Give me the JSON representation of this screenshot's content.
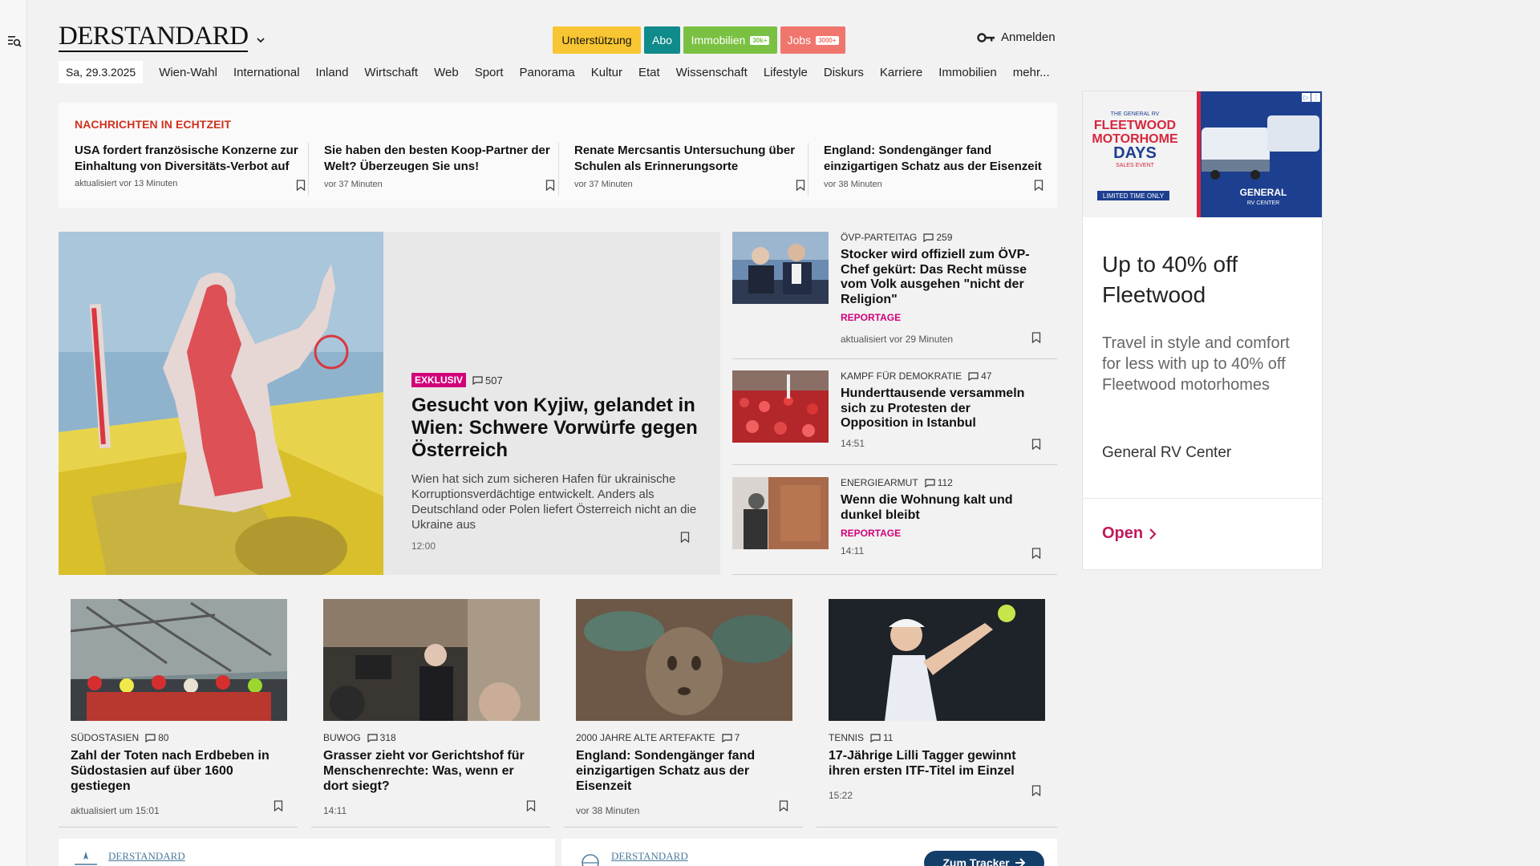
{
  "header": {
    "logo": "DERSTANDARD",
    "cta": [
      {
        "label": "Unterstützung"
      },
      {
        "label": "Abo"
      },
      {
        "label": "Immobilien",
        "badge": "30k+"
      },
      {
        "label": "Jobs",
        "badge": "3000+"
      }
    ],
    "login_label": "Anmelden"
  },
  "nav": {
    "date": "Sa, 29.3.2025",
    "items": [
      "Wien-Wahl",
      "International",
      "Inland",
      "Wirtschaft",
      "Web",
      "Sport",
      "Panorama",
      "Kultur",
      "Etat",
      "Wissenschaft",
      "Lifestyle",
      "Diskurs",
      "Karriere",
      "Immobilien",
      "mehr..."
    ]
  },
  "ticker": {
    "title": "NACHRICHTEN IN ECHTZEIT",
    "items": [
      {
        "title": "USA fordert französische Konzerne zur Einhaltung von Diversitäts-Verbot auf",
        "meta": "aktualisiert vor 13 Minuten"
      },
      {
        "title": "Sie haben den besten Koop-Partner der Welt? Überzeugen Sie uns!",
        "meta": "vor 37 Minuten"
      },
      {
        "title": "Renate Mercsantis Untersuchung über Schulen als Erinnerungsorte",
        "meta": "vor 37 Minuten"
      },
      {
        "title": "England: Sondengänger fand einzigartigen Schatz aus der Eisenzeit",
        "meta": "vor 38 Minuten"
      }
    ]
  },
  "hero": {
    "badge": "EXKLUSIV",
    "comments": "507",
    "title": "Gesucht von Kyjiw, gelandet in Wien: Schwere Vorwürfe gegen Österreich",
    "lead": "Wien hat sich zum sicheren Hafen für ukrainische Korruptionsverdächtige entwickelt. Anders als Deutschland oder Polen liefert Österreich nicht an die Ukraine aus",
    "time": "12:00"
  },
  "side": [
    {
      "kicker": "ÖVP-Parteitag",
      "comments": "259",
      "title": "Stocker wird offiziell zum ÖVP-Chef gekürt: Das Recht müsse vom Volk ausgehen \"nicht der Religion\"",
      "tag": "REPORTAGE",
      "time": "aktualisiert vor 29 Minuten"
    },
    {
      "kicker": "Kampf für Demokratie",
      "comments": "47",
      "title": "Hunderttausende versammeln sich zu Protesten der Opposition in Istanbul",
      "tag": "",
      "time": "14:51"
    },
    {
      "kicker": "Energiearmut",
      "comments": "112",
      "title": "Wenn die Wohnung kalt und dunkel bleibt",
      "tag": "REPORTAGE",
      "time": "14:11"
    }
  ],
  "cards": [
    {
      "kicker": "Südostasien",
      "comments": "80",
      "title": "Zahl der Toten nach Erdbeben in Südostasien auf über 1600 gestiegen",
      "time": "aktualisiert um 15:01"
    },
    {
      "kicker": "Buwog",
      "comments": "318",
      "title": "Grasser zieht vor Gerichtshof für Menschenrechte: Was, wenn er dort siegt?",
      "time": "14:11"
    },
    {
      "kicker": "2000 Jahre alte Artefakte",
      "comments": "7",
      "title": "England: Sondengänger fand einzigartigen Schatz aus der Eisenzeit",
      "time": "vor 38 Minuten"
    },
    {
      "kicker": "Tennis",
      "comments": "11",
      "title": "17-Jährige Lilli Tagger gewinnt ihren ersten ITF-Titel im Einzel",
      "time": "15:22"
    }
  ],
  "ad": {
    "banner_lines": [
      "THE GENERAL RV",
      "FLEETWOOD",
      "MOTORHOME",
      "DAYS",
      "SALES EVENT",
      "LIMITED TIME ONLY",
      "GENERAL",
      "RV CENTER"
    ],
    "headline": "Up to 40% off Fleetwood",
    "description": "Travel in style and comfort for less with up to 40% off Fleetwood motorhomes",
    "advertiser": "General RV Center",
    "cta": "Open"
  },
  "bottom": {
    "mini_logo_1": "DERSTANDARD",
    "mini_logo_2": "DERSTANDARD",
    "tracker_label": "Zum Tracker"
  },
  "colors": {
    "ticker_red": "#d0321f",
    "exklusiv": "#d1007a",
    "support": "#f8c632",
    "abo": "#0e8b8a",
    "immobilien": "#7ac143",
    "jobs": "#f0766d",
    "ad_link": "#c2185b",
    "tracker": "#133e6a"
  }
}
